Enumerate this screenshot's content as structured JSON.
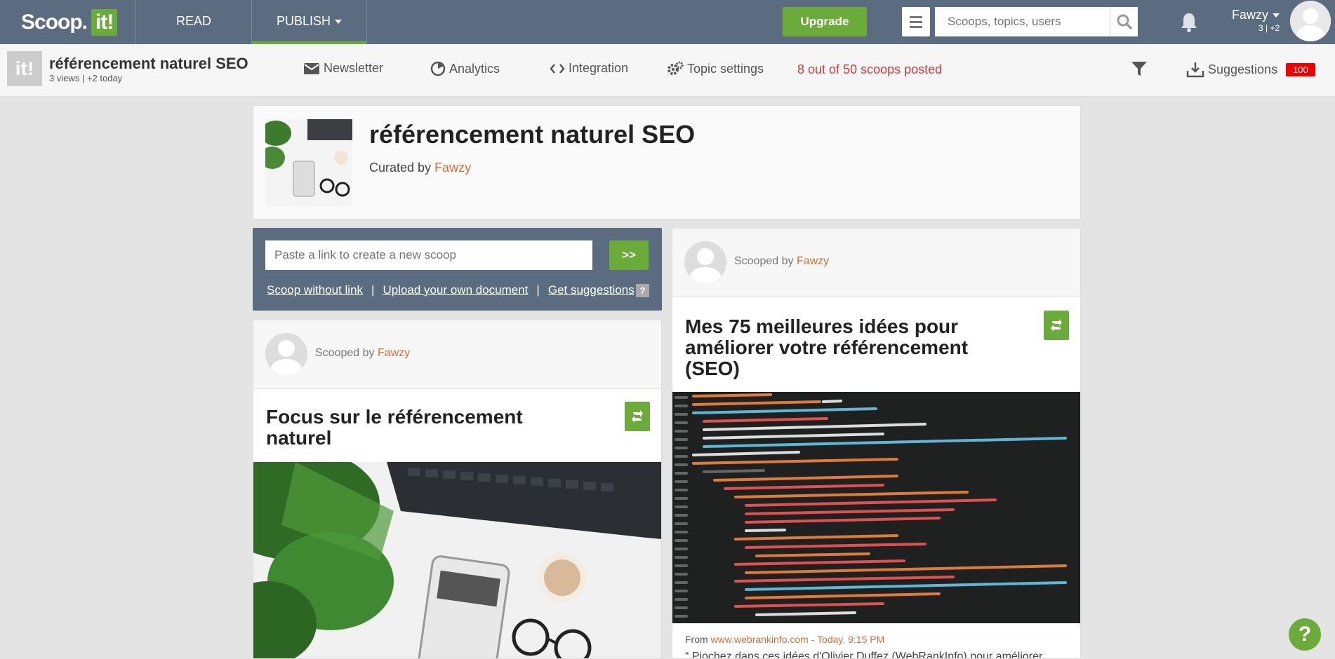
{
  "topbar": {
    "logo_text": "Scoop.",
    "logo_box": "it!",
    "nav": [
      "READ",
      "PUBLISH"
    ],
    "upgrade": "Upgrade",
    "search_placeholder": "Scoops, topics, users",
    "user_name": "Fawzy",
    "user_meta": "3 | +2"
  },
  "subbar": {
    "logo": "it!",
    "title": "référencement naturel SEO",
    "meta": "3 views | +2 today",
    "links": [
      "Newsletter",
      "Analytics",
      "Integration",
      "Topic settings"
    ],
    "scoops_posted": "8 out of 50 scoops posted",
    "suggestions": "Suggestions",
    "suggestions_count": "100"
  },
  "topic": {
    "title": "référencement naturel SEO",
    "curated_prefix": "Curated by ",
    "curator": "Fawzy"
  },
  "create": {
    "placeholder": "Paste a link to create a new scoop",
    "go": ">>",
    "links": [
      "Scoop without link",
      "Upload your own document",
      "Get suggestions"
    ],
    "separator": "|",
    "help": "?"
  },
  "posts": [
    {
      "scooped_prefix": "Scooped by ",
      "author": "Fawzy",
      "title_lines": [
        "Focus sur le référencement",
        "naturel"
      ]
    },
    {
      "scooped_prefix": "Scooped by ",
      "author": "Fawzy",
      "title_lines": [
        "Mes 75 meilleures idées pour",
        "améliorer votre référencement",
        "(SEO)"
      ],
      "from_prefix": "From ",
      "from_url": "www.webrankinfo.com",
      "from_date": " - Today, 9:15 PM",
      "snippet": "“ Piochez dans ces idées d'Olivier Duffez (WebRankInfo) pour améliorer"
    }
  ],
  "help_bubble": "?",
  "colors": {
    "topbar": "#5b6b80",
    "green": "#6aab3a",
    "orange": "#d2703c",
    "red": "#d43b3b"
  }
}
